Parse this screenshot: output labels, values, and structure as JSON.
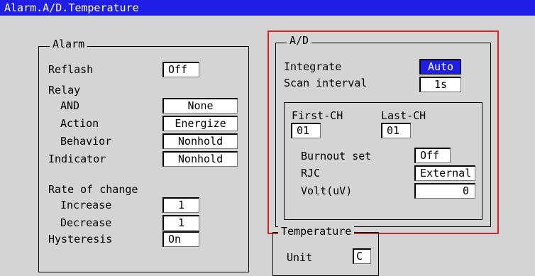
{
  "window": {
    "title": "Alarm.A/D.Temperature"
  },
  "alarm": {
    "legend": "Alarm",
    "reflash": {
      "label": "Reflash",
      "value": "Off"
    },
    "relay": {
      "label": "Relay",
      "and": {
        "label": "AND",
        "value": "None"
      },
      "action": {
        "label": "Action",
        "value": "Energize"
      },
      "behavior": {
        "label": "Behavior",
        "value": "Nonhold"
      }
    },
    "indicator": {
      "label": "Indicator",
      "value": "Nonhold"
    },
    "rate_of_change": {
      "label": "Rate of change",
      "increase": {
        "label": "Increase",
        "value": "1"
      },
      "decrease": {
        "label": "Decrease",
        "value": "1"
      }
    },
    "hysteresis": {
      "label": "Hysteresis",
      "value": "On"
    }
  },
  "ad": {
    "legend": "A/D",
    "integrate": {
      "label": "Integrate",
      "value": "Auto"
    },
    "scan_interval": {
      "label": "Scan interval",
      "value": "1s"
    },
    "first_ch": {
      "label": "First-CH",
      "value": "01"
    },
    "last_ch": {
      "label": "Last-CH",
      "value": "01"
    },
    "burnout_set": {
      "label": "Burnout set",
      "value": "Off"
    },
    "rjc": {
      "label": "RJC",
      "value": "External"
    },
    "volt": {
      "label": "Volt(uV)",
      "value": "0"
    }
  },
  "temperature": {
    "legend": "Temperature",
    "unit": {
      "label": "Unit",
      "value": "C"
    }
  },
  "colors": {
    "title_bar": "#1e1ee6",
    "highlight": "#e02020",
    "selected": "#1e1ee6"
  }
}
